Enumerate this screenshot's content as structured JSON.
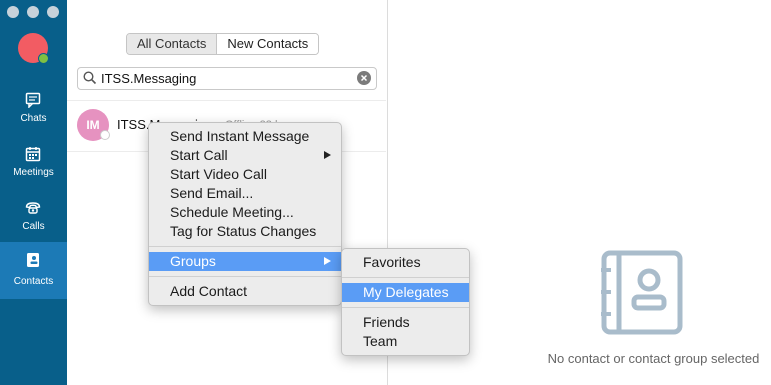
{
  "sidebar": {
    "nav": [
      {
        "label": "Chats",
        "icon": "chat-icon"
      },
      {
        "label": "Meetings",
        "icon": "calendar-icon"
      },
      {
        "label": "Calls",
        "icon": "phone-icon"
      },
      {
        "label": "Contacts",
        "icon": "contact-card-icon"
      }
    ],
    "active": "Contacts"
  },
  "list": {
    "tabs": [
      "All Contacts",
      "New Contacts"
    ],
    "search_value": "ITSS.Messaging",
    "contact": {
      "initials": "IM",
      "name": "ITSS.Messaging",
      "status": "Offline 23 h"
    }
  },
  "context_menu": {
    "items": [
      "Send Instant Message",
      "Start Call",
      "Start Video Call",
      "Send Email...",
      "Schedule Meeting...",
      "Tag for Status Changes"
    ],
    "groups_label": "Groups",
    "add_label": "Add Contact"
  },
  "submenu": {
    "favorites": "Favorites",
    "delegates": "My Delegates",
    "friends": "Friends",
    "team": "Team"
  },
  "detail": {
    "empty_text": "No contact or contact group selected"
  },
  "colors": {
    "sidebar": "#085f8a",
    "active_nav": "#1c7ab6",
    "highlight": "#5a9cf5"
  }
}
